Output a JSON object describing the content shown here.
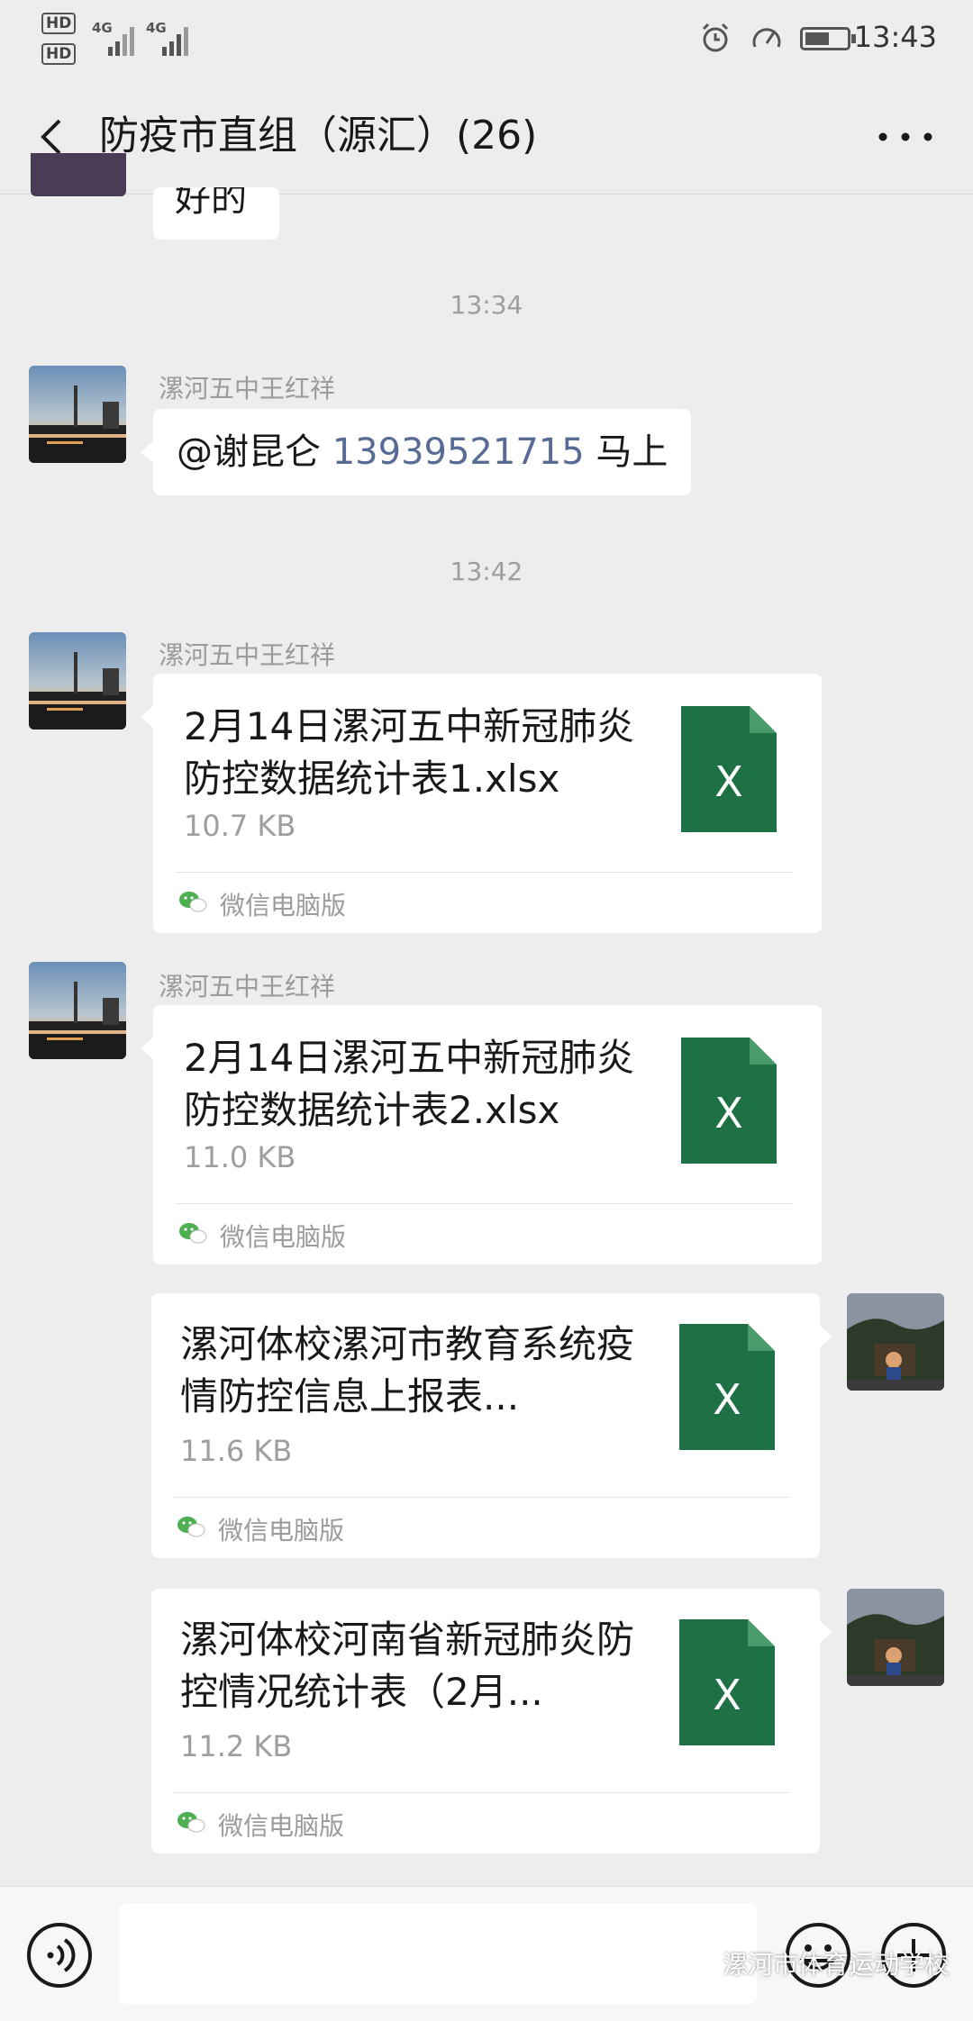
{
  "status_bar": {
    "hd1": "HD",
    "hd2": "HD",
    "net1": "4G",
    "net2": "4G",
    "time": "13:43"
  },
  "header": {
    "title": "防疫市直组（源汇）(26)"
  },
  "messages": {
    "prev_text": "好的",
    "ts1": "13:34",
    "m1_sender": "漯河五中王红祥",
    "m1_mention": "@谢昆仑",
    "m1_number": "13939521715",
    "m1_tail": "马上",
    "ts2": "13:42",
    "f1": {
      "sender": "漯河五中王红祥",
      "name": "2月14日漯河五中新冠肺炎防控数据统计表1.xlsx",
      "size": "10.7 KB",
      "source": "微信电脑版",
      "icon_letter": "X"
    },
    "f2": {
      "sender": "漯河五中王红祥",
      "name": "2月14日漯河五中新冠肺炎防控数据统计表2.xlsx",
      "size": "11.0 KB",
      "source": "微信电脑版",
      "icon_letter": "X"
    },
    "f3": {
      "name": "漯河体校漯河市教育系统疫情防控信息上报表...",
      "size": "11.6 KB",
      "source": "微信电脑版",
      "icon_letter": "X"
    },
    "f4": {
      "name": "漯河体校河南省新冠肺炎防控情况统计表（2月...",
      "size": "11.2 KB",
      "source": "微信电脑版",
      "icon_letter": "X"
    }
  },
  "watermark": "漯河市体育运动学校",
  "colors": {
    "background": "#ededed",
    "excel_green": "#1e7145",
    "excel_fold": "#4a9a6c",
    "link_blue": "#576b95",
    "wechat_green": "#4caf50"
  }
}
